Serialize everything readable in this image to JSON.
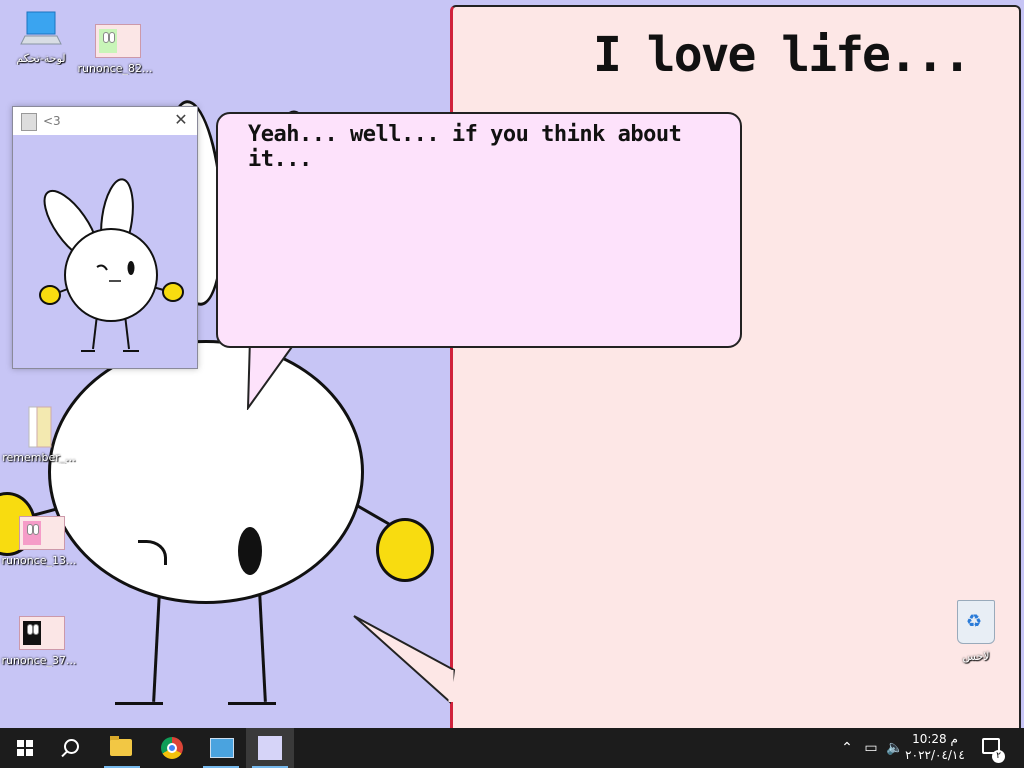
{
  "desktop": {
    "icons": [
      {
        "label": "لوحة-تحكم",
        "icon": "this-pc-icon"
      },
      {
        "label": "runonce_82...",
        "icon": "runonce-file-icon"
      },
      {
        "label": "remember_...",
        "icon": "file-icon"
      },
      {
        "label": "runonce_13...",
        "icon": "runonce-file-icon"
      },
      {
        "label": "runonce_37...",
        "icon": "runonce-file-icon"
      }
    ],
    "recycle_bin": {
      "label": "لاحس",
      "icon": "recycle-bin-icon"
    }
  },
  "note": {
    "title": "I love life..."
  },
  "bubble": {
    "text": "Yeah... well... if you think about it..."
  },
  "mini_window": {
    "title": "<3",
    "close_glyph": "✕"
  },
  "taskbar": {
    "apps": [
      "start",
      "search",
      "file-explorer",
      "chrome",
      "control-panel",
      "bunny-app"
    ],
    "active_app": "bunny-app",
    "clock": {
      "time": "10:28 م",
      "date": "٢٠٢٢/٠٤/١٤"
    },
    "notification_count": "٢"
  },
  "colors": {
    "desktop": "#c7c5f5",
    "note": "#fde7e6",
    "bubble": "#fde2fb",
    "hand": "#f8dc10",
    "taskbar": "#1c1c1c"
  }
}
